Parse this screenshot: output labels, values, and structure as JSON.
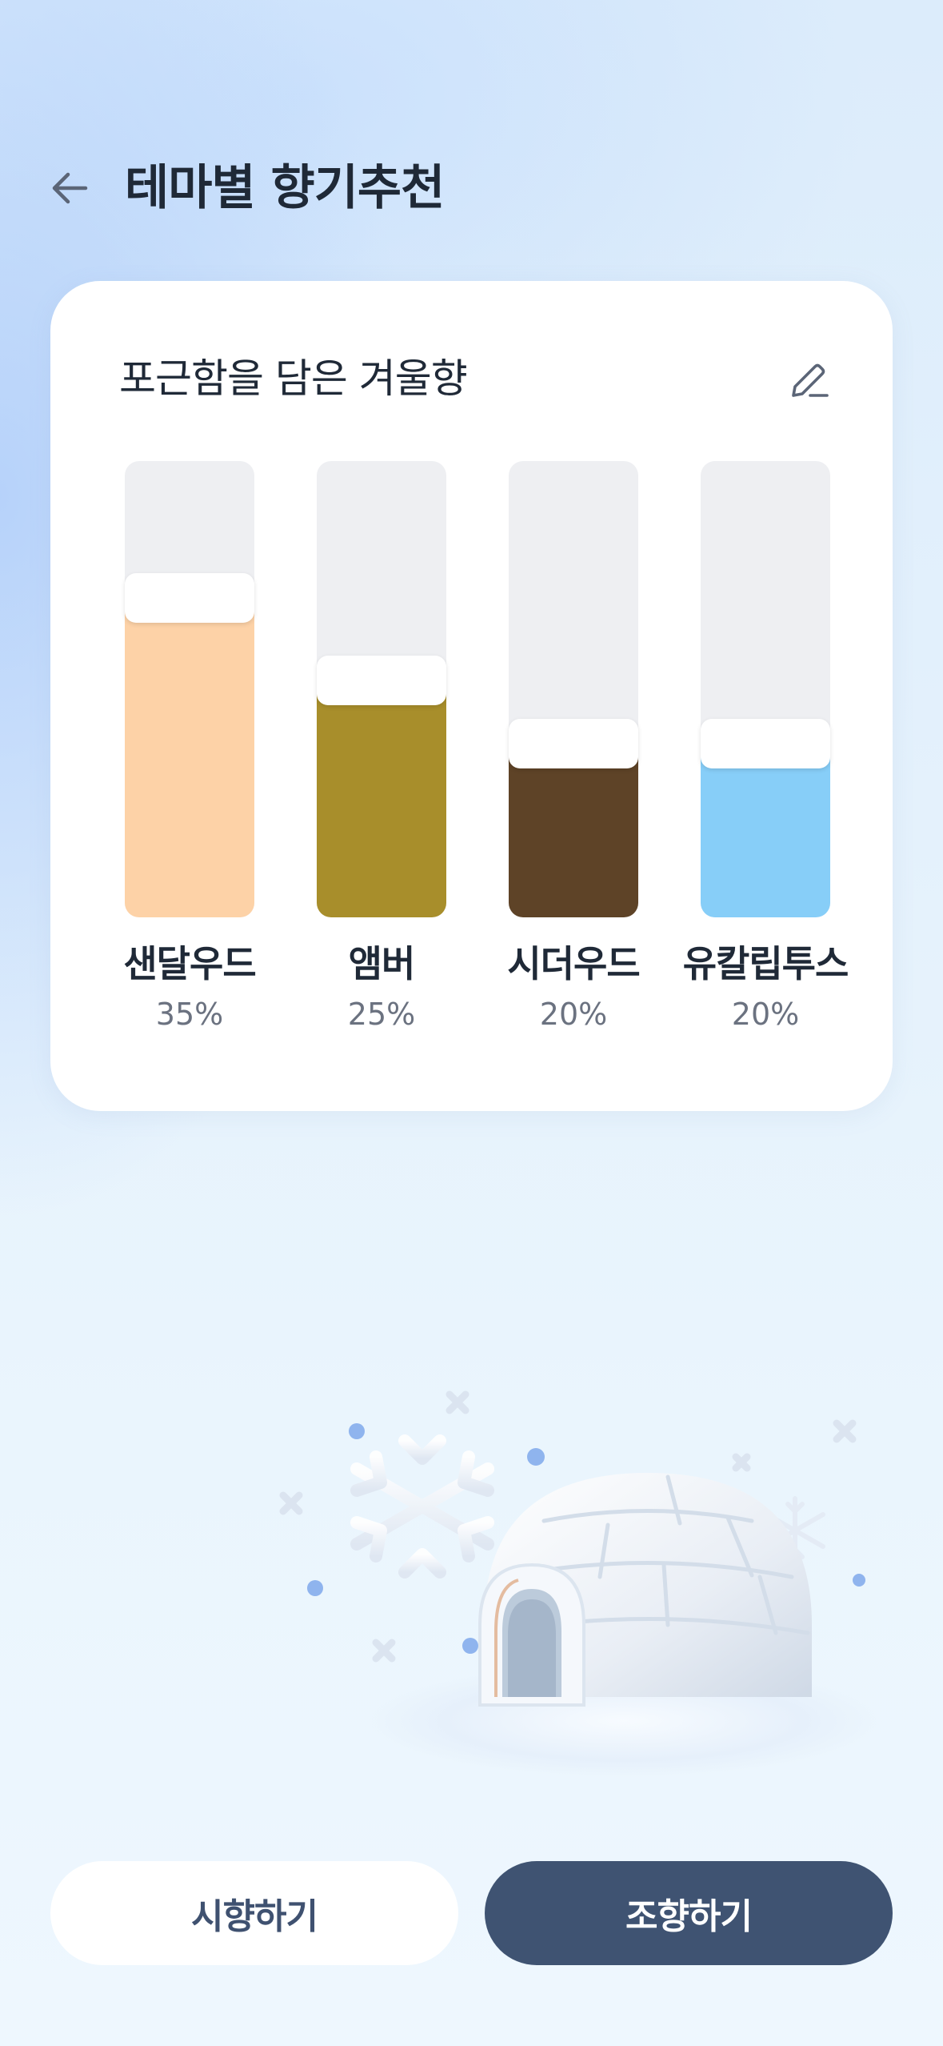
{
  "header": {
    "back_icon": "arrow-left-icon",
    "title": "테마별 향기추천"
  },
  "card": {
    "title": "포근함을 담은 겨울향",
    "edit_icon": "pencil-icon"
  },
  "chart_data": {
    "type": "bar",
    "categories": [
      "샌달우드",
      "앰버",
      "시더우드",
      "유칼립투스"
    ],
    "values": [
      35,
      25,
      20,
      20
    ],
    "value_labels": [
      "35%",
      "25%",
      "20%",
      "20%"
    ],
    "level_fractions": [
      0.7,
      0.52,
      0.38,
      0.38
    ],
    "colors": [
      "#fdd2a7",
      "#a88e2b",
      "#5e4327",
      "#87cef8"
    ],
    "track_color": "#eeeff2",
    "title": "",
    "xlabel": "",
    "ylabel": ""
  },
  "illustration": {
    "name": "igloo-snowflakes-illustration"
  },
  "actions": {
    "try_label": "시향하기",
    "blend_label": "조향하기"
  }
}
